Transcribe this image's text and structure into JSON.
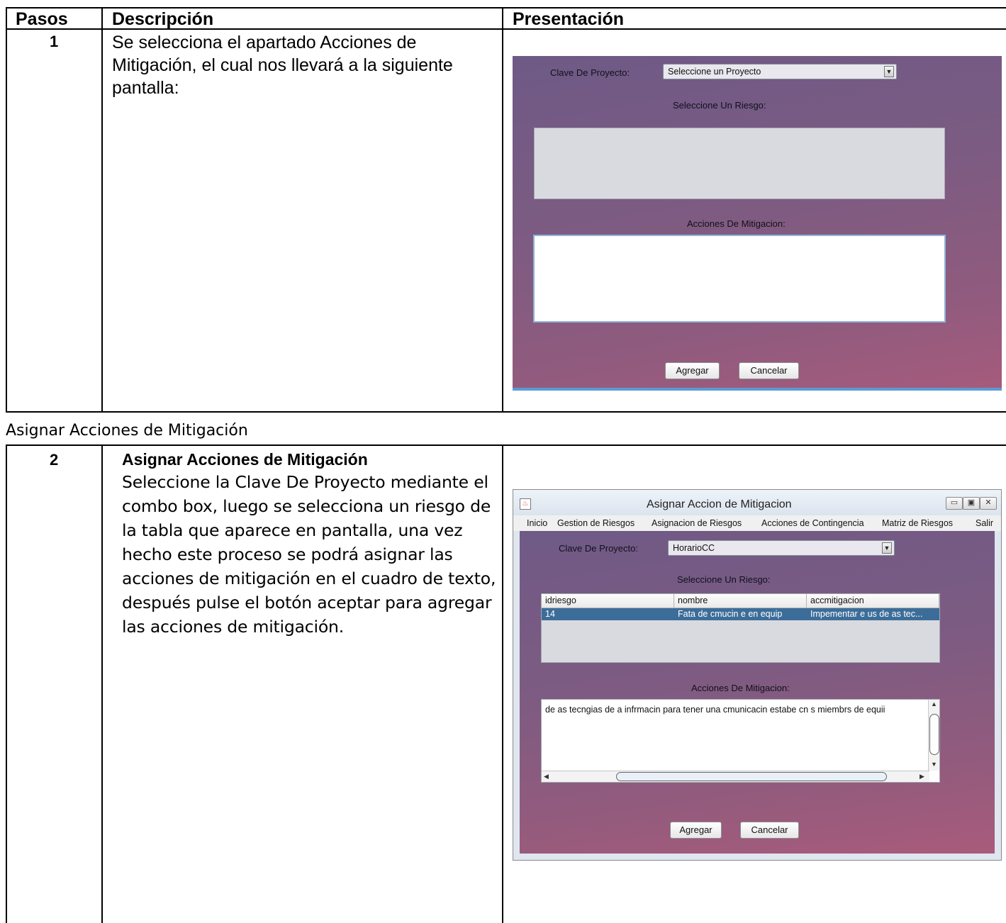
{
  "table": {
    "headers": {
      "pasos": "Pasos",
      "descripcion": "Descripción",
      "presentacion": "Presentación"
    }
  },
  "row1": {
    "step": "1",
    "description_lines": [
      "Se selecciona el apartado Acciones de",
      "Mitigación, el cual nos llevará a la siguiente",
      "pantalla:"
    ],
    "screen": {
      "clave_label": "Clave De Proyecto:",
      "combo_value": "Seleccione un Proyecto",
      "riesgo_label": "Seleccione Un Riesgo:",
      "acciones_label": "Acciones De Mitigacion:",
      "agregar": "Agregar",
      "cancelar": "Cancelar"
    }
  },
  "section_title": "Asignar Acciones de Mitigación",
  "row2": {
    "step": "2",
    "heading": "Asignar Acciones de Mitigación",
    "description_lines": [
      "Seleccione la Clave De Proyecto mediante el",
      "combo box, luego se selecciona un riesgo de",
      "la tabla que aparece en pantalla, una vez",
      "hecho este proceso se podrá asignar las",
      "acciones de mitigación en el cuadro de texto,",
      "después pulse el botón aceptar para agregar",
      "las acciones de mitigación."
    ],
    "window": {
      "title": "Asignar Accion de Mitigacion",
      "menu": [
        "Inicio",
        "Gestion de Riesgos",
        "Asignacion de Riesgos",
        "Acciones de Contingencia",
        "Matriz de Riesgos",
        "Salir"
      ],
      "clave_label": "Clave De Proyecto:",
      "combo_value": "HorarioCC",
      "riesgo_label": "Seleccione Un Riesgo:",
      "table_headers": [
        "idriesgo",
        "nombre",
        "accmitigacion"
      ],
      "table_row": [
        "14",
        "Fata de cmucin e en equip",
        "Impementar e us de as tec..."
      ],
      "acciones_label": "Acciones De Mitigacion:",
      "textarea_value": "de as tecngias de a infrmacin para tener una cmunicacin estabe cn s miembrs de equii",
      "agregar": "Agregar",
      "cancelar": "Cancelar"
    }
  }
}
